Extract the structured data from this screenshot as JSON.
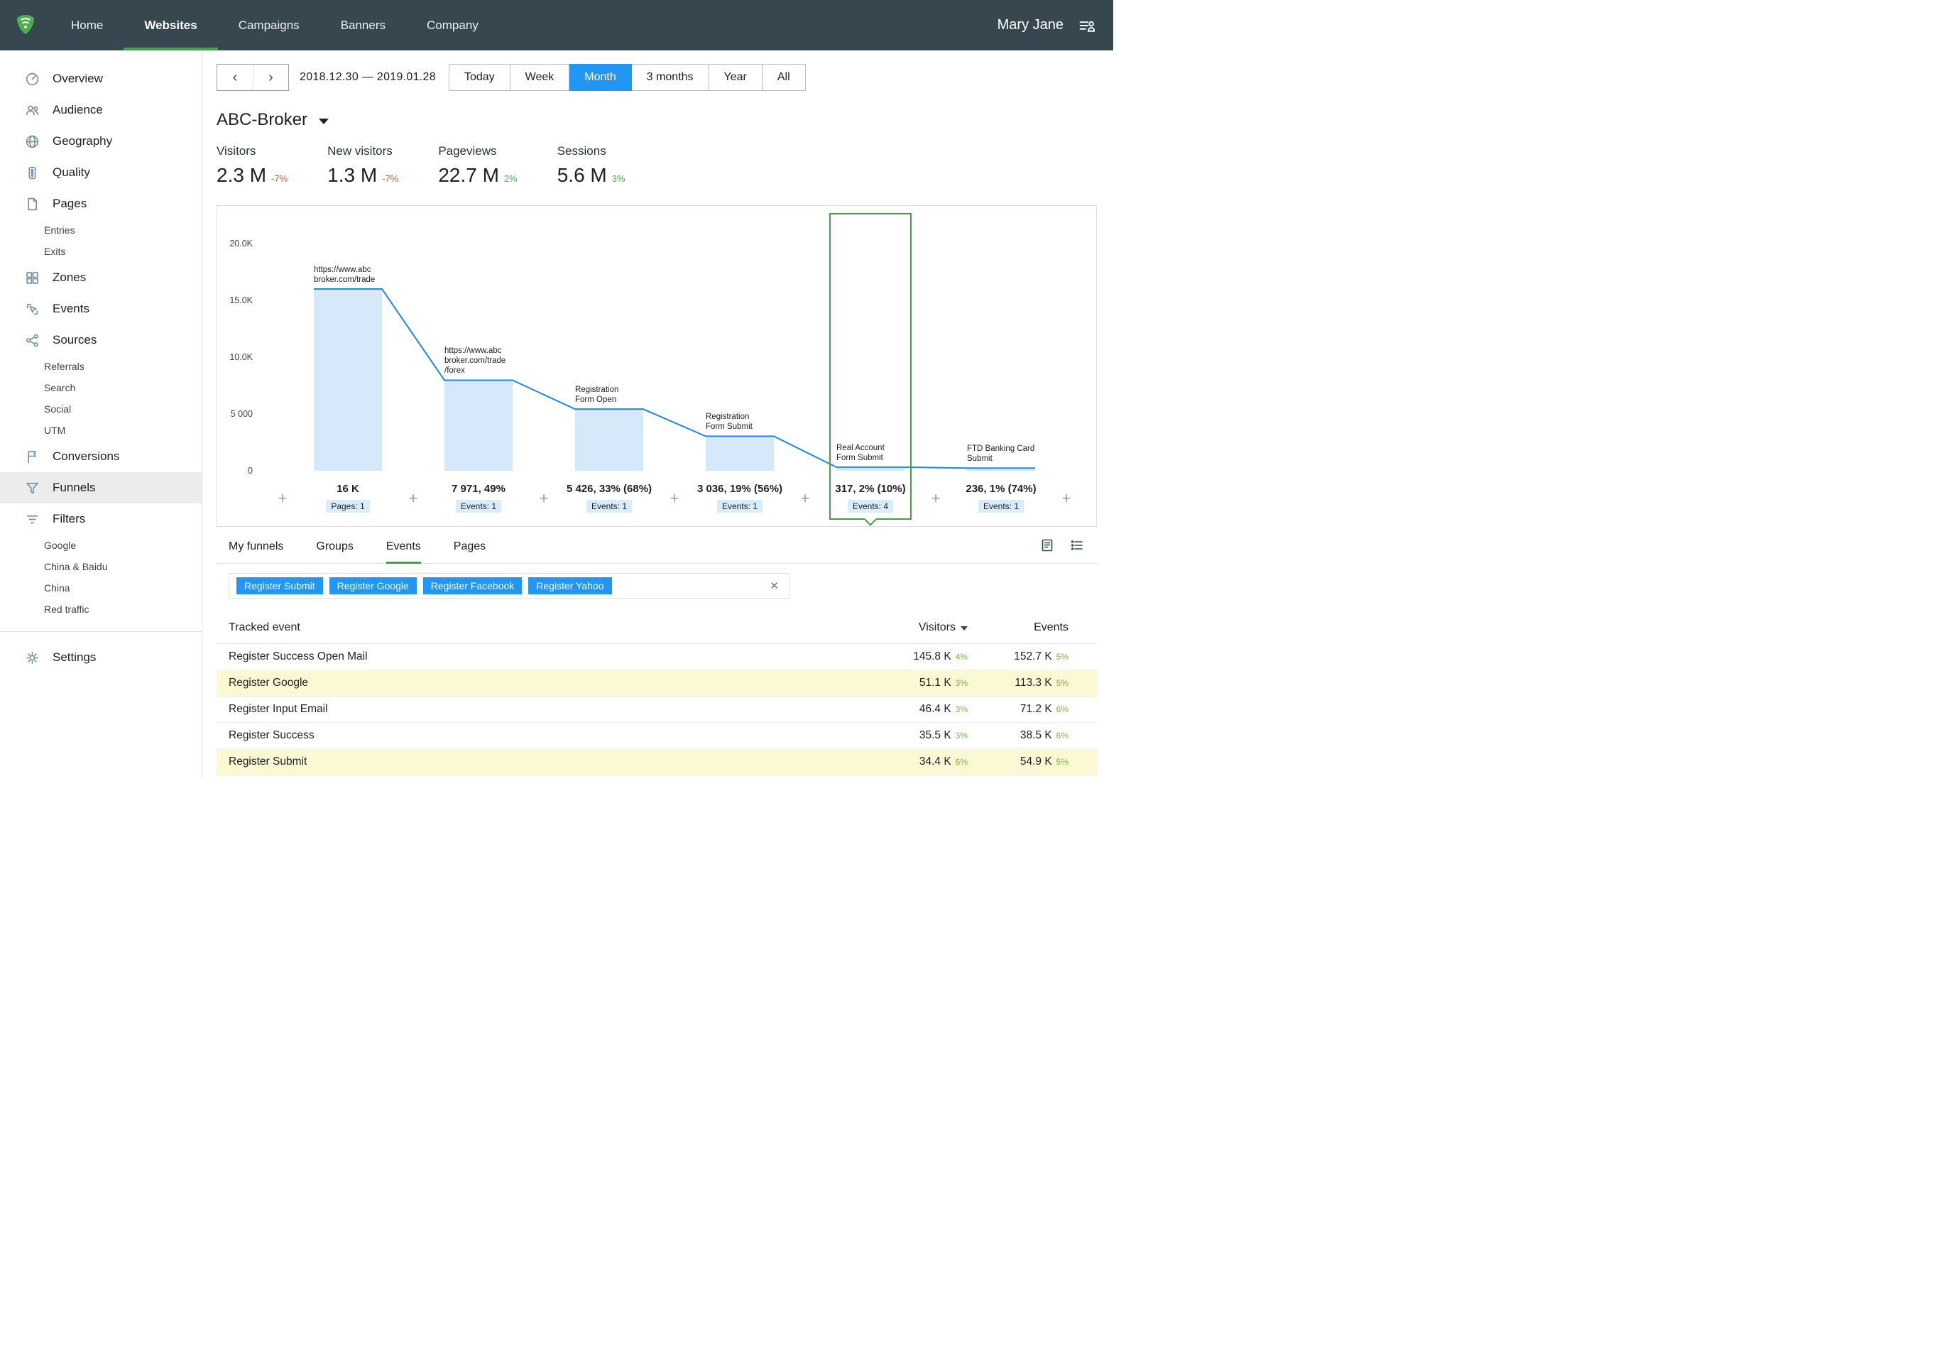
{
  "colors": {
    "topnav_bg": "#37474f",
    "accent_blue": "#2196f3",
    "accent_green": "#43a047",
    "bar_fill": "#d6e9fb",
    "line": "#1e88e5",
    "delta_up": "#4caf50",
    "delta_down": "#f4511e",
    "highlight_row": "#fbf9d3"
  },
  "topnav": {
    "items": [
      {
        "label": "Home"
      },
      {
        "label": "Websites"
      },
      {
        "label": "Campaigns"
      },
      {
        "label": "Banners"
      },
      {
        "label": "Company"
      }
    ],
    "active": "Websites",
    "user_name": "Mary Jane"
  },
  "sidebar": {
    "items": [
      {
        "label": "Overview",
        "type": "item",
        "icon": "gauge"
      },
      {
        "label": "Audience",
        "type": "item",
        "icon": "people"
      },
      {
        "label": "Geography",
        "type": "item",
        "icon": "globe"
      },
      {
        "label": "Quality",
        "type": "item",
        "icon": "traffic-light"
      },
      {
        "label": "Pages",
        "type": "item",
        "icon": "page"
      },
      {
        "label": "Entries",
        "type": "sub"
      },
      {
        "label": "Exits",
        "type": "sub"
      },
      {
        "label": "Zones",
        "type": "item",
        "icon": "grid"
      },
      {
        "label": "Events",
        "type": "item",
        "icon": "cursor"
      },
      {
        "label": "Sources",
        "type": "item",
        "icon": "share"
      },
      {
        "label": "Referrals",
        "type": "sub"
      },
      {
        "label": "Search",
        "type": "sub"
      },
      {
        "label": "Social",
        "type": "sub"
      },
      {
        "label": "UTM",
        "type": "sub"
      },
      {
        "label": "Conversions",
        "type": "item",
        "icon": "flag"
      },
      {
        "label": "Funnels",
        "type": "item",
        "icon": "funnel",
        "active": true
      },
      {
        "label": "Filters",
        "type": "item",
        "icon": "filter-lines"
      },
      {
        "label": "Google",
        "type": "sub"
      },
      {
        "label": "China & Baidu",
        "type": "sub"
      },
      {
        "label": "China",
        "type": "sub"
      },
      {
        "label": "Red traffic",
        "type": "sub"
      },
      {
        "label": "Settings",
        "type": "item",
        "icon": "gear"
      }
    ]
  },
  "toolbar": {
    "prev": "‹",
    "next": "›",
    "date_range": "2018.12.30  — 2019.01.28",
    "ranges": [
      "Today",
      "Week",
      "Month",
      "3 months",
      "Year",
      "All"
    ],
    "active_range": "Month"
  },
  "site": {
    "name": "ABC-Broker"
  },
  "metrics": [
    {
      "label": "Visitors",
      "value": "2.3 M",
      "delta": "-7%",
      "trend": "down"
    },
    {
      "label": "New visitors",
      "value": "1.3 M",
      "delta": "-7%",
      "trend": "down"
    },
    {
      "label": "Pageviews",
      "value": "22.7 M",
      "delta": "2%",
      "trend": "up"
    },
    {
      "label": "Sessions",
      "value": "5.6 M",
      "delta": "3%",
      "trend": "up"
    }
  ],
  "chart_data": {
    "type": "funnel",
    "ymax": 20000,
    "yticks": [
      "20.0K",
      "15.0K",
      "10.0K",
      "5 000",
      "0"
    ],
    "add_label": "+",
    "columns": [
      {
        "label": "https://www.abc\nbroker.com/trade",
        "value": 16000,
        "value_label": "16 K",
        "badge": "Pages: 1"
      },
      {
        "label": "https://www.abc\nbroker.com/trade\n/forex",
        "value": 7971,
        "value_label": "7 971, 49%",
        "badge": "Events: 1"
      },
      {
        "label": "Registration\nForm Open",
        "value": 5426,
        "value_label": "5 426, 33% (68%)",
        "badge": "Events: 1"
      },
      {
        "label": "Registration\nForm Submit",
        "value": 3036,
        "value_label": "3 036, 19% (56%)",
        "badge": "Events: 1"
      },
      {
        "label": "Real Account\nForm Submit",
        "value": 317,
        "value_label": "317, 2% (10%)",
        "badge": "Events: 4",
        "selected": true
      },
      {
        "label": "FTD Banking Card\nSubmit",
        "value": 236,
        "value_label": "236, 1% (74%)",
        "badge": "Events: 1"
      }
    ]
  },
  "tabs": {
    "items": [
      "My funnels",
      "Groups",
      "Events",
      "Pages"
    ],
    "active": "Events"
  },
  "filter": {
    "chips": [
      "Register Submit",
      "Register Google",
      "Register Facebook",
      "Register Yahoo"
    ],
    "clear": "✕"
  },
  "table": {
    "columns": {
      "event": "Tracked event",
      "visitors": "Visitors",
      "events": "Events"
    },
    "rows": [
      {
        "event": "Register Success Open Mail",
        "visitors": "145.8 K",
        "visitors_pct": "4%",
        "events": "152.7 K",
        "events_pct": "5%",
        "highlighted": false
      },
      {
        "event": "Register Google",
        "visitors": "51.1 K",
        "visitors_pct": "3%",
        "events": "113.3 K",
        "events_pct": "5%",
        "highlighted": true
      },
      {
        "event": "Register Input Email",
        "visitors": "46.4 K",
        "visitors_pct": "3%",
        "events": "71.2 K",
        "events_pct": "6%",
        "highlighted": false
      },
      {
        "event": "Register Success",
        "visitors": "35.5 K",
        "visitors_pct": "3%",
        "events": "38.5 K",
        "events_pct": "6%",
        "highlighted": false
      },
      {
        "event": "Register Submit",
        "visitors": "34.4 K",
        "visitors_pct": "6%",
        "events": "54.9 K",
        "events_pct": "5%",
        "highlighted": true
      }
    ]
  }
}
